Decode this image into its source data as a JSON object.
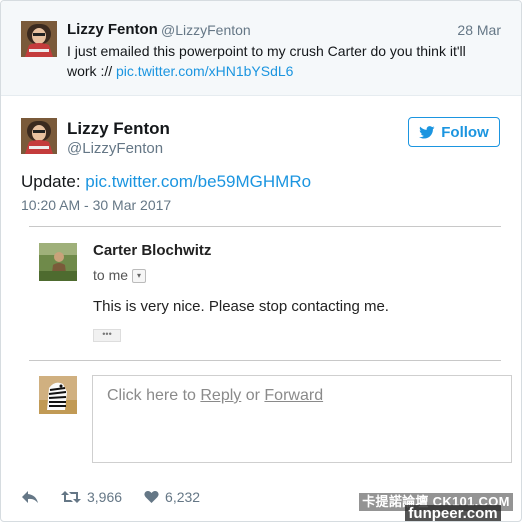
{
  "parent_tweet": {
    "name": "Lizzy Fenton",
    "handle": "@LizzyFenton",
    "date": "28 Mar",
    "text": "I just emailed this powerpoint to my crush Carter do you think it'll work :// ",
    "link": "pic.twitter.com/xHN1bYSdL6"
  },
  "tweet": {
    "name": "Lizzy Fenton",
    "handle": "@LizzyFenton",
    "follow_label": "Follow",
    "text_prefix": "Update: ",
    "link": "pic.twitter.com/be59MGHMRo",
    "timestamp": "10:20 AM - 30 Mar 2017"
  },
  "email": {
    "sender": "Carter Blochwitz",
    "to": "to me",
    "body": "This is very nice. Please stop contacting me.",
    "ellipsis": "•••",
    "reply_prompt": {
      "before": "Click here to ",
      "reply": "Reply",
      "or": " or ",
      "forward": "Forward"
    }
  },
  "actions": {
    "retweets": "3,966",
    "likes": "6,232"
  },
  "watermark": {
    "line1": "卡提諾論壇 CK101.COM",
    "line2": "funpeer.com"
  },
  "colors": {
    "accent": "#1b95e0",
    "muted": "#657786",
    "parent_bg": "#f5f8fa"
  }
}
